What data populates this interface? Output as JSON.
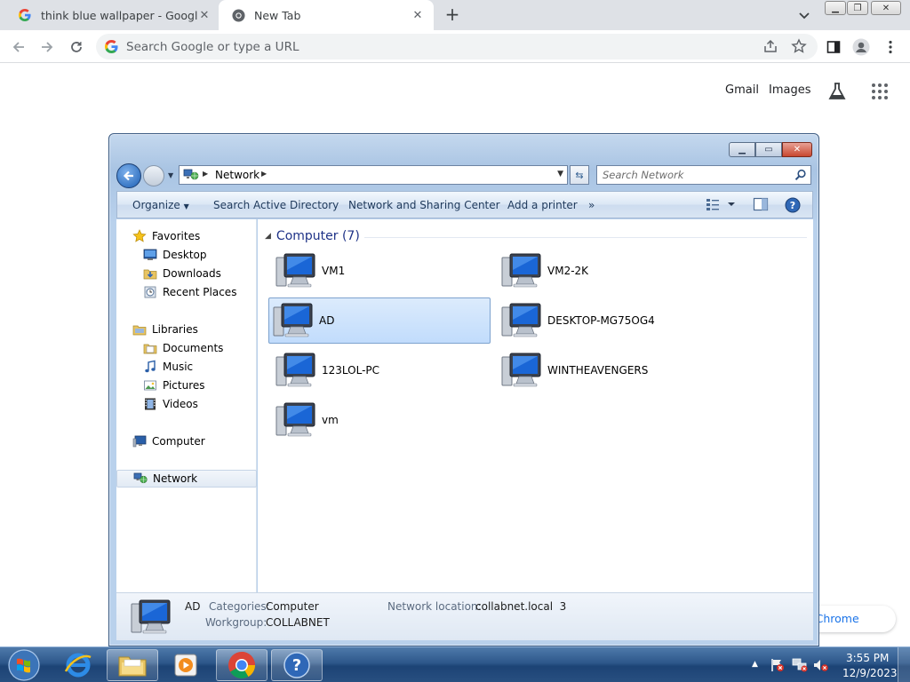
{
  "browser": {
    "tabs": [
      {
        "title": "think blue wallpaper - Google Se"
      },
      {
        "title": "New Tab"
      }
    ],
    "omnibox_placeholder": "Search Google or type a URL",
    "ntp": {
      "gmail": "Gmail",
      "images": "Images",
      "customize": "nize Chrome"
    }
  },
  "explorer": {
    "address": {
      "crumb": "Network"
    },
    "search_placeholder": "Search Network",
    "commands": {
      "organize": "Organize",
      "search_ad": "Search Active Directory",
      "sharing_center": "Network and Sharing Center",
      "add_printer": "Add a printer",
      "more": "»"
    },
    "nav": {
      "favorites": "Favorites",
      "desktop": "Desktop",
      "downloads": "Downloads",
      "recent": "Recent Places",
      "libraries": "Libraries",
      "documents": "Documents",
      "music": "Music",
      "pictures": "Pictures",
      "videos": "Videos",
      "computer": "Computer",
      "network": "Network"
    },
    "group_header": "Computer (7)",
    "computers": [
      "VM1",
      "VM2-2K",
      "AD",
      "DESKTOP-MG75OG4",
      "123LOL-PC",
      "WINTHEAVENGERS",
      "vm"
    ],
    "selected": "AD",
    "details": {
      "name": "AD",
      "categories_label": "Categories:",
      "categories_value": "Computer",
      "workgroup_label": "Workgroup:",
      "workgroup_value": "COLLABNET",
      "network_location_label": "Network location:",
      "network_location_value": "collabnet.local  3"
    }
  },
  "taskbar": {
    "time": "3:55 PM",
    "date": "12/9/2023"
  },
  "colors": {
    "chrome_tabstrip": "#dee1e6",
    "explorer_frame": "#b9d1ec",
    "selection": "#c1dcfc",
    "taskbar": "#2d578a"
  }
}
